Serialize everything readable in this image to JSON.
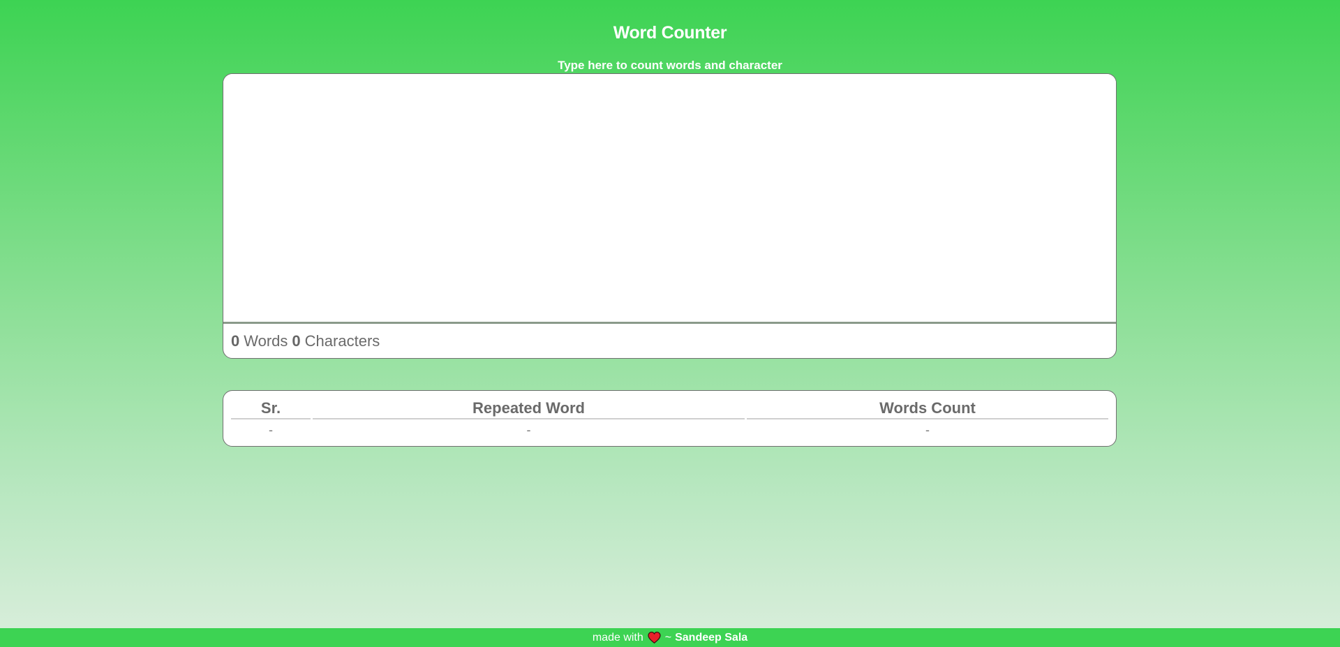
{
  "header": {
    "title": "Word Counter",
    "subtitle": "Type here to count words and character"
  },
  "editor": {
    "value": "",
    "placeholder": ""
  },
  "stats": {
    "word_count": "0",
    "words_label": "Words",
    "char_count": "0",
    "chars_label": "Characters"
  },
  "table": {
    "headers": [
      "Sr.",
      "Repeated Word",
      "Words Count"
    ],
    "rows": [
      [
        "-",
        "-",
        "-"
      ]
    ]
  },
  "footer": {
    "made_with": "made with",
    "separator": "~",
    "author": "Sandeep Sala",
    "heart_icon": "heart-icon"
  },
  "colors": {
    "accent_green": "#3dd353",
    "heart_red": "#e8202a",
    "text_gray": "#6a6a6a"
  }
}
